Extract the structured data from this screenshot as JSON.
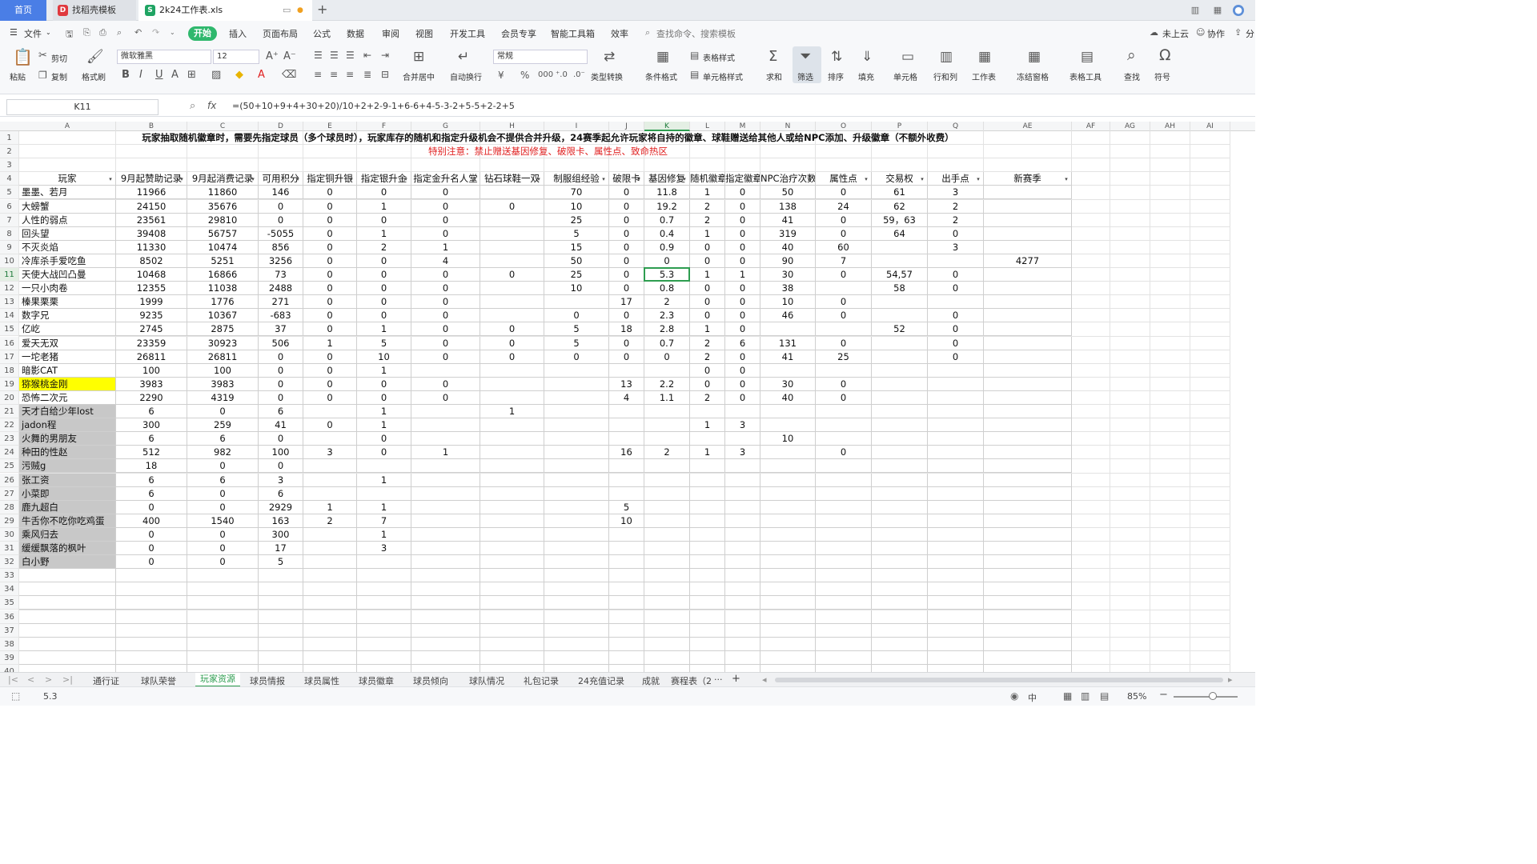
{
  "window": {
    "tabs": [
      {
        "label": "首页"
      },
      {
        "label": "找稻壳模板"
      },
      {
        "label": "2k24工作表.xls"
      }
    ],
    "new_tab": "+"
  },
  "menu": {
    "file": "文件",
    "items": [
      "开始",
      "插入",
      "页面布局",
      "公式",
      "数据",
      "审阅",
      "视图",
      "开发工具",
      "会员专享",
      "智能工具箱",
      "效率"
    ],
    "search_placeholder": "查找命令、搜索模板",
    "right": [
      "未上云",
      "协作",
      "分"
    ]
  },
  "ribbon": {
    "paste": "粘贴",
    "cut": "剪切",
    "copy": "复制",
    "format_painter": "格式刷",
    "font_name": "微软雅黑",
    "font_size": "12",
    "number_format": "常规",
    "merge": "合并居中",
    "wrap": "自动换行",
    "type_convert": "类型转换",
    "cond_format": "条件格式",
    "table_style": "表格样式",
    "cell_style": "单元格样式",
    "sum": "求和",
    "filter": "筛选",
    "sort": "排序",
    "fill": "填充",
    "cell": "单元格",
    "rowcol": "行和列",
    "worksheet": "工作表",
    "freeze": "冻结窗格",
    "table_tools": "表格工具",
    "find": "查找",
    "symbol": "符号"
  },
  "formula_bar": {
    "name_box": "K11",
    "fx": "fx",
    "formula": "=(50+10+9+4+30+20)/10+2+2-9-1+6-6+4-5-3-2+5-5+2-2+5"
  },
  "sheet": {
    "col_letters": [
      "A",
      "B",
      "C",
      "D",
      "E",
      "F",
      "G",
      "H",
      "I",
      "J",
      "K",
      "L",
      "M",
      "N",
      "O",
      "P",
      "Q",
      "AE",
      "AF",
      "AG",
      "AH",
      "AI"
    ],
    "selected_col": "K",
    "selected_row": 11,
    "row_numbers": [
      1,
      2,
      3,
      4,
      5,
      6,
      7,
      8,
      9,
      10,
      11,
      12,
      13,
      14,
      15,
      16,
      17,
      18,
      19,
      20,
      21,
      22,
      23,
      24,
      25,
      26,
      27,
      28,
      29,
      30,
      31,
      32,
      33,
      34,
      35,
      36,
      37,
      38,
      39,
      40
    ],
    "title": "玩家抽取随机徽章时，需要先指定球员（多个球员时），玩家库存的随机和指定升级机会不提供合并升级，24赛季起允许玩家将自持的徽章、球鞋赠送给其他人或给NPC添加、升级徽章（不额外收费）",
    "warning": "特别注意：禁止赠送基因修复、破限卡、属性点、致命热区",
    "headers": [
      "玩家",
      "9月起赞助记录",
      "9月起消费记录",
      "可用积分",
      "指定铜升银",
      "指定银升金",
      "指定金升名人堂",
      "钻石球鞋一双",
      "制服组经验",
      "破限卡",
      "基因修复",
      "随机徽章",
      "指定徽章",
      "NPC治疗次数",
      "属性点",
      "交易权",
      "出手点",
      "新赛季"
    ],
    "rows": [
      [
        "墨墨、若月",
        "11966",
        "11860",
        "146",
        "0",
        "0",
        "0",
        "",
        "70",
        "0",
        "11.8",
        "1",
        "0",
        "50",
        "0",
        "61",
        "3",
        ""
      ],
      [
        "大螃蟹",
        "24150",
        "35676",
        "0",
        "0",
        "1",
        "0",
        "0",
        "10",
        "0",
        "19.2",
        "2",
        "0",
        "138",
        "24",
        "62",
        "2",
        ""
      ],
      [
        "人性的弱点",
        "23561",
        "29810",
        "0",
        "0",
        "0",
        "0",
        "",
        "25",
        "0",
        "0.7",
        "2",
        "0",
        "41",
        "0",
        "59，63",
        "2",
        ""
      ],
      [
        "回头望",
        "39408",
        "56757",
        "-5055",
        "0",
        "1",
        "0",
        "",
        "5",
        "0",
        "0.4",
        "1",
        "0",
        "319",
        "0",
        "64",
        "0",
        ""
      ],
      [
        "不灭炎焰",
        "11330",
        "10474",
        "856",
        "0",
        "2",
        "1",
        "",
        "15",
        "0",
        "0.9",
        "0",
        "0",
        "40",
        "60",
        "",
        "3",
        ""
      ],
      [
        "冷库杀手爱吃鱼",
        "8502",
        "5251",
        "3256",
        "0",
        "0",
        "4",
        "",
        "50",
        "0",
        "0",
        "0",
        "0",
        "90",
        "7",
        "",
        "",
        "4277"
      ],
      [
        "天使大战凹凸曼",
        "10468",
        "16866",
        "73",
        "0",
        "0",
        "0",
        "0",
        "25",
        "0",
        "5.3",
        "1",
        "1",
        "30",
        "0",
        "54,57",
        "0",
        ""
      ],
      [
        "一只小肉卷",
        "12355",
        "11038",
        "2488",
        "0",
        "0",
        "0",
        "",
        "10",
        "0",
        "0.8",
        "0",
        "0",
        "38",
        "",
        "58",
        "0",
        ""
      ],
      [
        "榛果栗栗",
        "1999",
        "1776",
        "271",
        "0",
        "0",
        "0",
        "",
        "",
        "17",
        "2",
        "0",
        "0",
        "10",
        "0",
        "",
        "",
        ""
      ],
      [
        "数字兄",
        "9235",
        "10367",
        "-683",
        "0",
        "0",
        "0",
        "",
        "0",
        "0",
        "2.3",
        "0",
        "0",
        "46",
        "0",
        "",
        "0",
        ""
      ],
      [
        "亿屹",
        "2745",
        "2875",
        "37",
        "0",
        "1",
        "0",
        "0",
        "5",
        "18",
        "2.8",
        "1",
        "0",
        "",
        "",
        "52",
        "0",
        ""
      ],
      [
        "爱天无双",
        "23359",
        "30923",
        "506",
        "1",
        "5",
        "0",
        "0",
        "5",
        "0",
        "0.7",
        "2",
        "6",
        "131",
        "0",
        "",
        "0",
        ""
      ],
      [
        "一坨老猪",
        "26811",
        "26811",
        "0",
        "0",
        "10",
        "0",
        "0",
        "0",
        "0",
        "0",
        "2",
        "0",
        "41",
        "25",
        "",
        "0",
        ""
      ],
      [
        "暗影CAT",
        "100",
        "100",
        "0",
        "0",
        "1",
        "",
        "",
        "",
        "",
        "",
        "0",
        "0",
        "",
        "",
        "",
        "",
        ""
      ],
      [
        "猕猴桃金刚",
        "3983",
        "3983",
        "0",
        "0",
        "0",
        "0",
        "",
        "",
        "13",
        "2.2",
        "0",
        "0",
        "30",
        "0",
        "",
        "",
        ""
      ],
      [
        "恐怖二次元",
        "2290",
        "4319",
        "0",
        "0",
        "0",
        "0",
        "",
        "",
        "4",
        "1.1",
        "2",
        "0",
        "40",
        "0",
        "",
        "",
        ""
      ],
      [
        "天才白给少年lost",
        "6",
        "0",
        "6",
        "",
        "1",
        "",
        "1",
        "",
        "",
        "",
        "",
        "",
        "",
        "",
        "",
        "",
        ""
      ],
      [
        "jadon程",
        "300",
        "259",
        "41",
        "0",
        "1",
        "",
        "",
        "",
        "",
        "",
        "1",
        "3",
        "",
        "",
        "",
        "",
        ""
      ],
      [
        "火舞的男朋友",
        "6",
        "6",
        "0",
        "",
        "0",
        "",
        "",
        "",
        "",
        "",
        "",
        "",
        "10",
        "",
        "",
        "",
        ""
      ],
      [
        "种田的性赵",
        "512",
        "982",
        "100",
        "3",
        "0",
        "1",
        "",
        "",
        "16",
        "2",
        "1",
        "3",
        "",
        "0",
        "",
        "",
        ""
      ],
      [
        "污贼g",
        "18",
        "0",
        "0",
        "",
        "",
        "",
        "",
        "",
        "",
        "",
        "",
        "",
        "",
        "",
        "",
        "",
        ""
      ],
      [
        "张工资",
        "6",
        "6",
        "3",
        "",
        "1",
        "",
        "",
        "",
        "",
        "",
        "",
        "",
        "",
        "",
        "",
        "",
        ""
      ],
      [
        "小菜即",
        "6",
        "0",
        "6",
        "",
        "",
        "",
        "",
        "",
        "",
        "",
        "",
        "",
        "",
        "",
        "",
        "",
        ""
      ],
      [
        "鹿九超白",
        "0",
        "0",
        "2929",
        "1",
        "1",
        "",
        "",
        "",
        "5",
        "",
        "",
        "",
        "",
        "",
        "",
        "",
        ""
      ],
      [
        "牛舌你不吃你吃鸡蛋",
        "400",
        "1540",
        "163",
        "2",
        "7",
        "",
        "",
        "",
        "10",
        "",
        "",
        "",
        "",
        "",
        "",
        "",
        ""
      ],
      [
        "乘风归去",
        "0",
        "0",
        "300",
        "",
        "1",
        "",
        "",
        "",
        "",
        "",
        "",
        "",
        "",
        "",
        "",
        "",
        ""
      ],
      [
        "缓缓飘落的枫叶",
        "0",
        "0",
        "17",
        "",
        "3",
        "",
        "",
        "",
        "",
        "",
        "",
        "",
        "",
        "",
        "",
        "",
        ""
      ],
      [
        "白小野",
        "0",
        "0",
        "5",
        "",
        "",
        "",
        "",
        "",
        "",
        "",
        "",
        "",
        "",
        "",
        "",
        "",
        ""
      ]
    ]
  },
  "sheet_tabs": {
    "items": [
      "通行证",
      "球队荣誉",
      "玩家资源",
      "球员情报",
      "球员属性",
      "球员徽章",
      "球员倾向",
      "球队情况",
      "礼包记录",
      "24充值记录",
      "成就",
      "赛程表（2"
    ],
    "active": "玩家资源",
    "more": "···",
    "add": "+"
  },
  "status": {
    "value": "5.3",
    "zoom": "85%",
    "lang": "中"
  },
  "colors": {
    "accent": "#2e9d50",
    "home_tab": "#4a7ee6",
    "warning": "#e02020",
    "highlight": "#ffff00",
    "gray_fill": "#c8c8c8"
  }
}
